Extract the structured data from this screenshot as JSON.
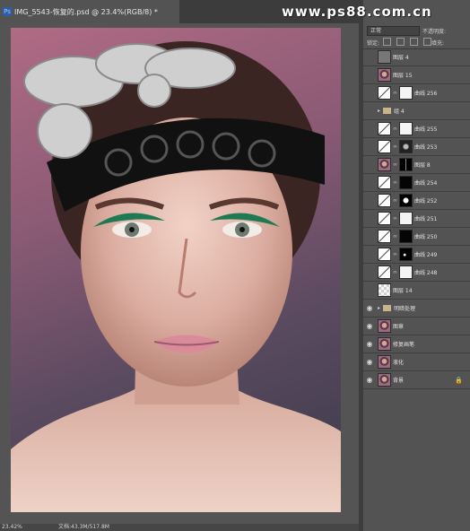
{
  "document": {
    "badge": "Ps",
    "title": "IMG_5543-恢复的.psd @ 23.4%(RGB/8) *"
  },
  "watermark": "www.ps88.com.cn",
  "status": {
    "zoom": "23.42%",
    "doc": "文档:43.3M/517.8M"
  },
  "layers_panel": {
    "blend_mode": "正常",
    "opacity_label": "不透明度:",
    "lock_label": "锁定:",
    "fill_label": "填充:",
    "layers": [
      {
        "name": "图层 4",
        "visible": false,
        "thumb": "gray"
      },
      {
        "name": "图层 15",
        "visible": false,
        "thumb": "face"
      },
      {
        "name": "曲线 256",
        "visible": false,
        "thumb": "adj",
        "mask": "white"
      },
      {
        "name": "组 4",
        "visible": false,
        "group": true
      },
      {
        "name": "曲线 255",
        "visible": false,
        "thumb": "adj",
        "mask": "white"
      },
      {
        "name": "曲线 253",
        "visible": false,
        "thumb": "adj",
        "mask": "maskface"
      },
      {
        "name": "图层 8",
        "visible": false,
        "thumb": "face",
        "mask": "maskvert"
      },
      {
        "name": "曲线 254",
        "visible": false,
        "thumb": "adj",
        "mask": "black"
      },
      {
        "name": "曲线 252",
        "visible": false,
        "thumb": "adj",
        "mask": "maskdot"
      },
      {
        "name": "曲线 251",
        "visible": false,
        "thumb": "adj",
        "mask": "white"
      },
      {
        "name": "曲线 250",
        "visible": false,
        "thumb": "adj",
        "mask": "black"
      },
      {
        "name": "曲线 249",
        "visible": false,
        "thumb": "adj",
        "mask": "maskspot"
      },
      {
        "name": "曲线 248",
        "visible": false,
        "thumb": "adj",
        "mask": "white"
      },
      {
        "name": "图层 14",
        "visible": false,
        "thumb": "checker"
      },
      {
        "name": "明暗处理",
        "visible": true,
        "group": true
      },
      {
        "name": "图章",
        "visible": true,
        "thumb": "face"
      },
      {
        "name": "修复画笔",
        "visible": true,
        "thumb": "face"
      },
      {
        "name": "液化",
        "visible": true,
        "thumb": "face"
      },
      {
        "name": "背景",
        "visible": true,
        "thumb": "face",
        "locked": true
      }
    ]
  }
}
